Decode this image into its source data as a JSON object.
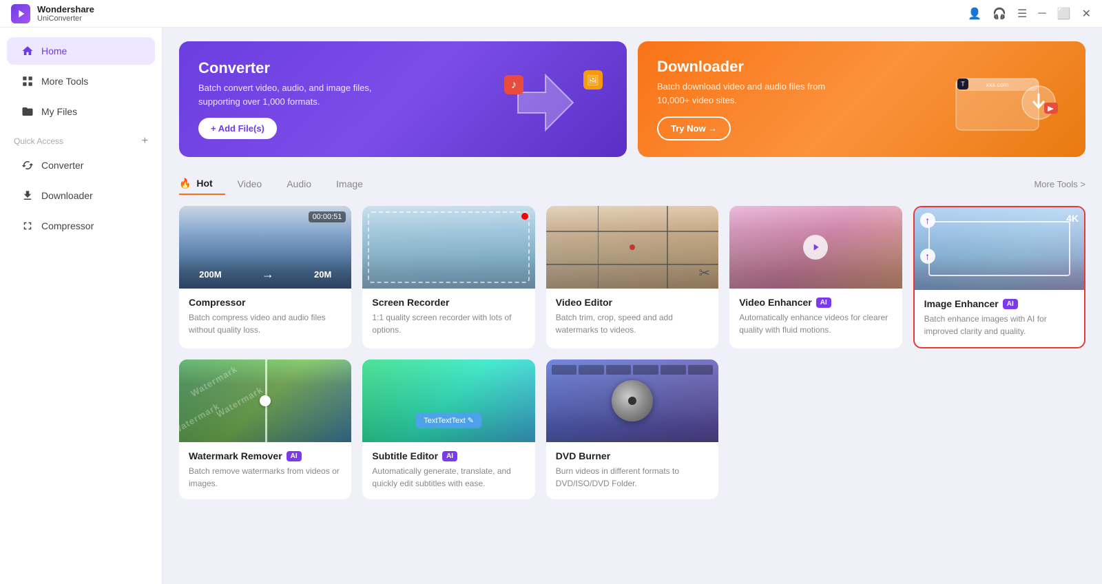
{
  "titlebar": {
    "app_name": "Wondershare",
    "app_subtitle": "UniConverter",
    "controls": [
      "profile-icon",
      "headset-icon",
      "menu-icon",
      "minimize-icon",
      "maximize-icon",
      "close-icon"
    ]
  },
  "sidebar": {
    "nav_items": [
      {
        "id": "home",
        "label": "Home",
        "icon": "home-icon",
        "active": true
      },
      {
        "id": "more-tools",
        "label": "More Tools",
        "icon": "grid-icon",
        "active": false
      },
      {
        "id": "my-files",
        "label": "My Files",
        "icon": "folder-icon",
        "active": false
      }
    ],
    "quick_access_label": "Quick Access",
    "quick_access_items": [
      {
        "id": "converter",
        "label": "Converter",
        "icon": "converter-icon"
      },
      {
        "id": "downloader",
        "label": "Downloader",
        "icon": "downloader-icon"
      },
      {
        "id": "compressor",
        "label": "Compressor",
        "icon": "compressor-icon"
      }
    ]
  },
  "banners": [
    {
      "id": "converter",
      "title": "Converter",
      "description": "Batch convert video, audio, and image files, supporting over 1,000 formats.",
      "button_label": "+ Add File(s)",
      "button_type": "white"
    },
    {
      "id": "downloader",
      "title": "Downloader",
      "description": "Batch download video and audio files from 10,000+ video sites.",
      "button_label": "Try Now →",
      "button_type": "outline"
    }
  ],
  "tabs": [
    {
      "id": "hot",
      "label": "Hot",
      "active": true,
      "has_fire": true
    },
    {
      "id": "video",
      "label": "Video",
      "active": false
    },
    {
      "id": "audio",
      "label": "Audio",
      "active": false
    },
    {
      "id": "image",
      "label": "Image",
      "active": false
    }
  ],
  "more_tools_link": "More Tools >",
  "tools": [
    {
      "id": "compressor",
      "title": "Compressor",
      "description": "Batch compress video and audio files without quality loss.",
      "has_ai": false,
      "highlighted": false,
      "timer": "00:00:51",
      "size_from": "200M",
      "size_to": "20M"
    },
    {
      "id": "screen-recorder",
      "title": "Screen Recorder",
      "description": "1:1 quality screen recorder with lots of options.",
      "has_ai": false,
      "highlighted": false
    },
    {
      "id": "video-editor",
      "title": "Video Editor",
      "description": "Batch trim, crop, speed and add watermarks to videos.",
      "has_ai": false,
      "highlighted": false
    },
    {
      "id": "video-enhancer",
      "title": "Video Enhancer",
      "description": "Automatically enhance videos for clearer quality with fluid motions.",
      "has_ai": true,
      "highlighted": false
    },
    {
      "id": "image-enhancer",
      "title": "Image Enhancer",
      "description": "Batch enhance images with AI for improved clarity and quality.",
      "has_ai": true,
      "highlighted": true,
      "badge_4k": "4K"
    },
    {
      "id": "watermark-remover",
      "title": "Watermark Remover",
      "description": "Batch remove watermarks from videos or images.",
      "has_ai": true,
      "highlighted": false
    },
    {
      "id": "subtitle-editor",
      "title": "Subtitle Editor",
      "description": "Automatically generate, translate, and quickly edit subtitles with ease.",
      "has_ai": true,
      "highlighted": false,
      "subtitle_text": "TextTextText ✎"
    },
    {
      "id": "dvd-burner",
      "title": "DVD Burner",
      "description": "Burn videos in different formats to DVD/ISO/DVD Folder.",
      "has_ai": false,
      "highlighted": false
    }
  ]
}
